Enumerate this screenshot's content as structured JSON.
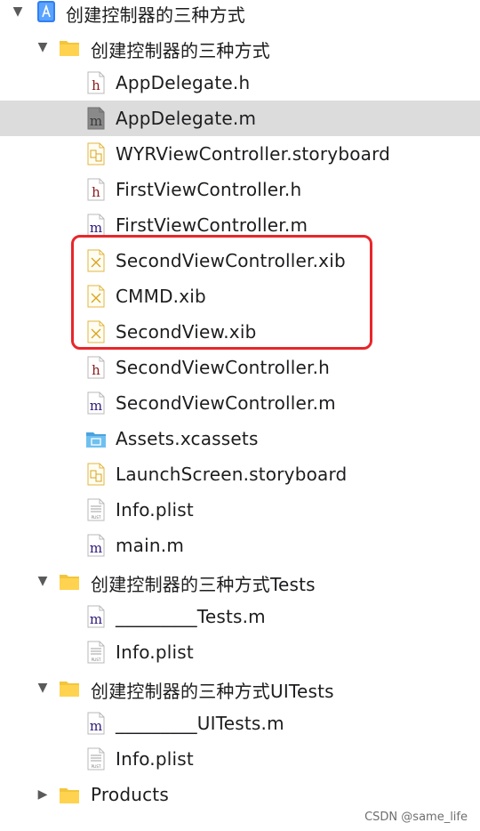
{
  "tree": [
    {
      "label": "创建控制器的三种方式",
      "type": "project",
      "level": 0,
      "disclosure": "expanded"
    },
    {
      "label": "创建控制器的三种方式",
      "type": "folder",
      "level": 1,
      "disclosure": "expanded"
    },
    {
      "label": "AppDelegate.h",
      "type": "h",
      "level": 2
    },
    {
      "label": "AppDelegate.m",
      "type": "m-gray",
      "level": 2,
      "selected": true
    },
    {
      "label": "WYRViewController.storyboard",
      "type": "storyboard",
      "level": 2
    },
    {
      "label": "FirstViewController.h",
      "type": "h",
      "level": 2
    },
    {
      "label": "FirstViewController.m",
      "type": "m",
      "level": 2
    },
    {
      "label": "SecondViewController.xib",
      "type": "xib",
      "level": 2
    },
    {
      "label": "CMMD.xib",
      "type": "xib",
      "level": 2
    },
    {
      "label": "SecondView.xib",
      "type": "xib",
      "level": 2
    },
    {
      "label": "SecondViewController.h",
      "type": "h",
      "level": 2
    },
    {
      "label": "SecondViewController.m",
      "type": "m",
      "level": 2
    },
    {
      "label": "Assets.xcassets",
      "type": "assets",
      "level": 2
    },
    {
      "label": "LaunchScreen.storyboard",
      "type": "storyboard",
      "level": 2
    },
    {
      "label": "Info.plist",
      "type": "plist",
      "level": 2
    },
    {
      "label": "main.m",
      "type": "m",
      "level": 2
    },
    {
      "label": "创建控制器的三种方式Tests",
      "type": "folder",
      "level": 1,
      "disclosure": "expanded"
    },
    {
      "label": "_________Tests.m",
      "type": "m",
      "level": 2
    },
    {
      "label": "Info.plist",
      "type": "plist",
      "level": 2
    },
    {
      "label": "创建控制器的三种方式UITests",
      "type": "folder",
      "level": 1,
      "disclosure": "expanded"
    },
    {
      "label": "_________UITests.m",
      "type": "m",
      "level": 2
    },
    {
      "label": "Info.plist",
      "type": "plist",
      "level": 2
    },
    {
      "label": "Products",
      "type": "folder",
      "level": 1,
      "disclosure": "collapsed"
    }
  ],
  "highlight_color": "#e8262a",
  "watermark": "CSDN @same_life",
  "icon_names": {
    "project": "xcode-project-icon",
    "folder": "folder-icon",
    "h": "header-file-icon",
    "m": "objc-file-icon",
    "m-gray": "objc-file-icon",
    "storyboard": "storyboard-file-icon",
    "xib": "xib-file-icon",
    "assets": "asset-catalog-icon",
    "plist": "plist-file-icon"
  }
}
